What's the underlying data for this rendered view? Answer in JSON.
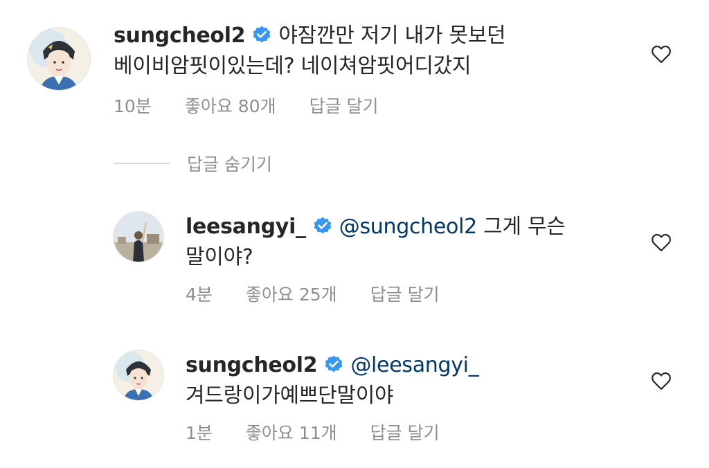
{
  "comments": [
    {
      "username": "sungcheol2",
      "mention": "",
      "text_line1": "야잠깐만 저기 내가 못보던",
      "text_line2": "베이비암핏이있는데? 네이쳐암핏어디갔지",
      "time": "10분",
      "likes": "좋아요 80개",
      "reply": "답글 달기",
      "avatar_icon": "illustrated-portrait-avatar"
    },
    {
      "username": "leesangyi_",
      "mention": "@sungcheol2",
      "text_line1": "그게 무슨",
      "text_line2": "말이야?",
      "time": "4분",
      "likes": "좋아요 25개",
      "reply": "답글 달기",
      "avatar_icon": "photo-avatar"
    },
    {
      "username": "sungcheol2",
      "mention": "@leesangyi_",
      "text_line1": "",
      "text_line2": "겨드랑이가예쁘단말이야",
      "time": "1분",
      "likes": "좋아요 11개",
      "reply": "답글 달기",
      "avatar_icon": "illustrated-portrait-avatar"
    }
  ],
  "hide_replies_label": "답글 숨기기",
  "icons": {
    "verified": "verified-badge-icon",
    "like": "heart-outline-icon"
  },
  "colors": {
    "verified_blue": "#3897f0",
    "mention": "#00376b",
    "meta_gray": "#8e8e8e"
  }
}
